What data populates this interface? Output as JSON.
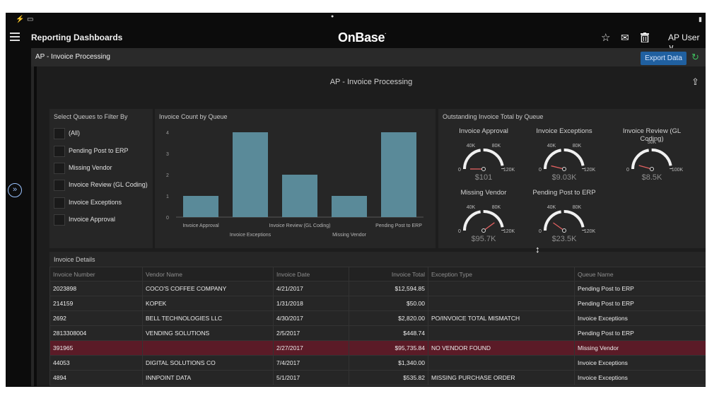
{
  "app": {
    "section_title": "Reporting Dashboards",
    "brand": "OnBase",
    "user_label": "AP User",
    "user_caret": "∨"
  },
  "page_header": {
    "title": "AP - Invoice Processing",
    "export_label": "Export Data"
  },
  "dashboard": {
    "title": "AP - Invoice Processing"
  },
  "filter_panel": {
    "title": "Select Queues to Filter By",
    "items": [
      "(All)",
      "Pending Post to ERP",
      "Missing Vendor",
      "Invoice Review (GL Coding)",
      "Invoice Exceptions",
      "Invoice Approval"
    ]
  },
  "chart_data": {
    "type": "bar",
    "title": "Invoice Count by Queue",
    "categories": [
      "Invoice Approval",
      "Invoice Exceptions",
      "Invoice Review (GL Coding)",
      "Missing Vendor",
      "Pending Post to ERP"
    ],
    "values": [
      1,
      4,
      2,
      1,
      4
    ],
    "yticks": [
      "0",
      "1",
      "2",
      "3",
      "4"
    ],
    "ylim": [
      0,
      4
    ],
    "bar_color": "#5a8a99"
  },
  "gauges": {
    "title": "Outstanding Invoice Total by Queue",
    "items": [
      {
        "label": "Invoice Approval",
        "value": "$101",
        "ticks": [
          "0",
          "40K",
          "80K",
          "120K"
        ]
      },
      {
        "label": "Invoice Exceptions",
        "value": "$9.03K",
        "ticks": [
          "0",
          "40K",
          "80K",
          "120K"
        ]
      },
      {
        "label": "Invoice Review (GL Coding)",
        "value": "$8.5K",
        "ticks": [
          "0",
          "50K",
          "100K"
        ]
      },
      {
        "label": "Missing Vendor",
        "value": "$95.7K",
        "ticks": [
          "0",
          "40K",
          "80K",
          "120K"
        ]
      },
      {
        "label": "Pending Post to ERP",
        "value": "$23.5K",
        "ticks": [
          "0",
          "40K",
          "80K",
          "120K"
        ]
      }
    ]
  },
  "invoice_table": {
    "title": "Invoice Details",
    "columns": [
      "Invoice Number",
      "Vendor Name",
      "Invoice Date",
      "Invoice Total",
      "Exception Type",
      "Queue Name"
    ],
    "rows": [
      [
        "2023898",
        "COCO'S COFFEE COMPANY",
        "4/21/2017",
        "$12,594.85",
        "",
        "Pending Post to ERP"
      ],
      [
        "214159",
        "KOPEK",
        "1/31/2018",
        "$50.00",
        "",
        "Pending Post to ERP"
      ],
      [
        "2692",
        "BELL TECHNOLOGIES LLC",
        "4/30/2017",
        "$2,820.00",
        "PO/INVOICE TOTAL MISMATCH",
        "Invoice Exceptions"
      ],
      [
        "2813308004",
        "VENDING SOLUTIONS",
        "2/5/2017",
        "$448.74",
        "",
        "Pending Post to ERP"
      ],
      [
        "391965",
        "",
        "2/27/2017",
        "$95,735.84",
        "NO VENDOR FOUND",
        "Missing Vendor"
      ],
      [
        "44053",
        "DIGITAL SOLUTIONS CO",
        "7/4/2017",
        "$1,340.00",
        "",
        "Invoice Exceptions"
      ],
      [
        "4894",
        "INNPOINT DATA",
        "5/1/2017",
        "$535.82",
        "MISSING PURCHASE ORDER",
        "Invoice Exceptions"
      ]
    ],
    "highlight_row": 4,
    "highlight_color": "#5b1b27"
  },
  "colors": {
    "accent": "#2060a0",
    "refresh": "#3fbf5f",
    "bar": "#5a8a99"
  }
}
